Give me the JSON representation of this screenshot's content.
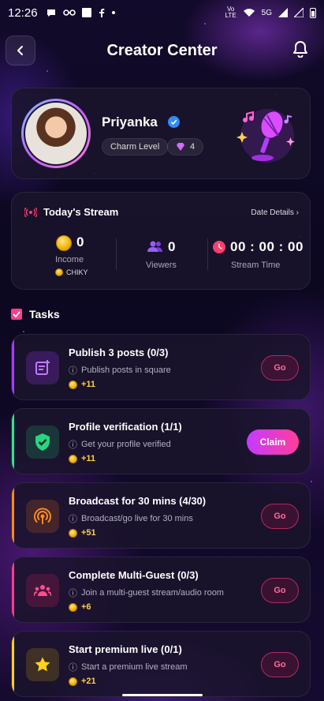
{
  "status_bar": {
    "time": "12:26",
    "network": "5G"
  },
  "header": {
    "title": "Creator Center"
  },
  "profile": {
    "name": "Priyanka",
    "charm_label": "Charm Level",
    "charm_value": "4"
  },
  "stream": {
    "title": "Today's Stream",
    "date_details": "Date Details",
    "income_value": "0",
    "income_label": "Income",
    "currency": "CHIKY",
    "viewers_value": "0",
    "viewers_label": "Viewers",
    "time_value": "00 : 00 : 00",
    "time_label": "Stream Time"
  },
  "tasks": {
    "title": "Tasks",
    "items": [
      {
        "title": "Publish 3 posts (0/3)",
        "desc": "Publish posts in square",
        "reward": "+11",
        "action": "Go",
        "accent": "#a53cff",
        "icon": "post-add-icon"
      },
      {
        "title": "Profile verification (1/1)",
        "desc": "Get your profile verified",
        "reward": "+11",
        "action": "Claim",
        "accent": "#2ee68f",
        "icon": "shield-check-icon"
      },
      {
        "title": "Broadcast for 30 mins (4/30)",
        "desc": "Broadcast/go live for 30 mins",
        "reward": "+51",
        "action": "Go",
        "accent": "#ff8a1c",
        "icon": "broadcast-icon"
      },
      {
        "title": "Complete Multi-Guest (0/3)",
        "desc": "Join a multi-guest stream/audio room",
        "reward": "+6",
        "action": "Go",
        "accent": "#ff3d8a",
        "icon": "group-icon"
      },
      {
        "title": "Start premium live (0/1)",
        "desc": "Start a premium live stream",
        "reward": "+21",
        "action": "Go",
        "accent": "#ffd21c",
        "icon": "star-icon"
      }
    ]
  }
}
